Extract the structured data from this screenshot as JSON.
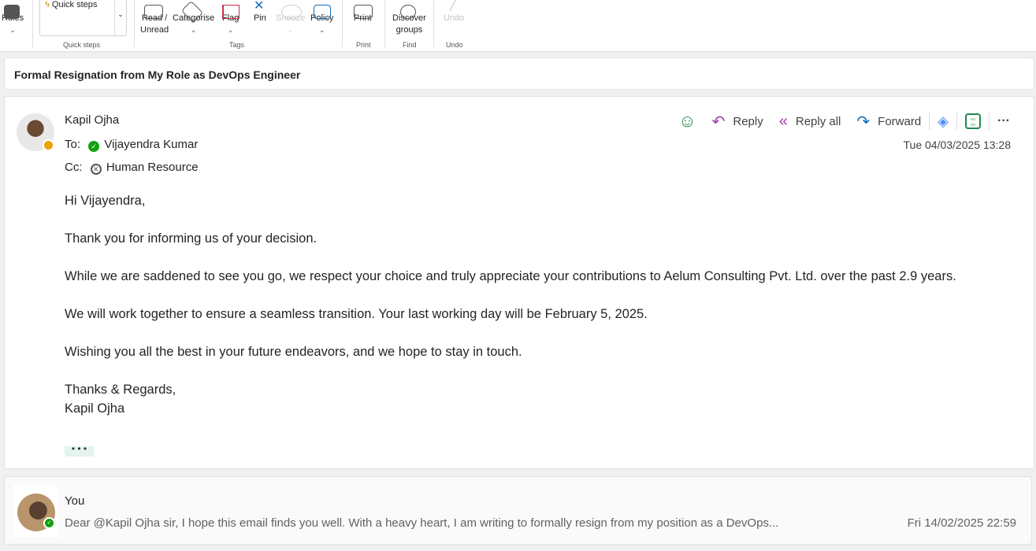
{
  "ribbon": {
    "rules": "Rules",
    "quick_steps": "Quick steps",
    "quick_steps_group": "Quick steps",
    "read_unread": [
      "Read /",
      "Unread"
    ],
    "categorise": "Categorise",
    "flag": "Flag",
    "pin": "Pin",
    "snooze": "Snooze",
    "policy": "Policy",
    "tags_group": "Tags",
    "print": "Print",
    "print_group": "Print",
    "discover_groups": [
      "Discover",
      "groups"
    ],
    "find_group": "Find",
    "undo": "Undo",
    "undo_group": "Undo"
  },
  "subject": "Formal Resignation from My Role as DevOps Engineer",
  "message": {
    "sender": "Kapil Ojha",
    "to_label": "To:",
    "to": "Vijayendra Kumar",
    "cc_label": "Cc:",
    "cc": "Human Resource",
    "date": "Tue 04/03/2025 13:28",
    "actions": {
      "reply": "Reply",
      "reply_all": "Reply all",
      "forward": "Forward"
    },
    "body": [
      "Hi Vijayendra,",
      "Thank you for informing us of your decision.",
      "While we are saddened to see you go, we respect your choice and truly appreciate your contributions to Aelum Consulting Pvt. Ltd. over the past 2.9 years.",
      "We will work together to ensure a seamless transition. Your last working day will be February 5, 2025.",
      "Wishing you all the best in your future endeavors, and we hope to stay in touch."
    ],
    "signoff": "Thanks & Regards,",
    "signature": "Kapil Ojha",
    "more": "• • •"
  },
  "previous": {
    "sender": "You",
    "preview": "Dear @Kapil Ojha sir, I hope this email finds you well. With a heavy heart, I am writing to formally resign from my position as a DevOps...",
    "date": "Fri 14/02/2025 22:59"
  },
  "colors": {
    "away": "#eaa300",
    "available": "#13a10e",
    "reply": "#a33ab0",
    "forward": "#0f6cbd"
  }
}
